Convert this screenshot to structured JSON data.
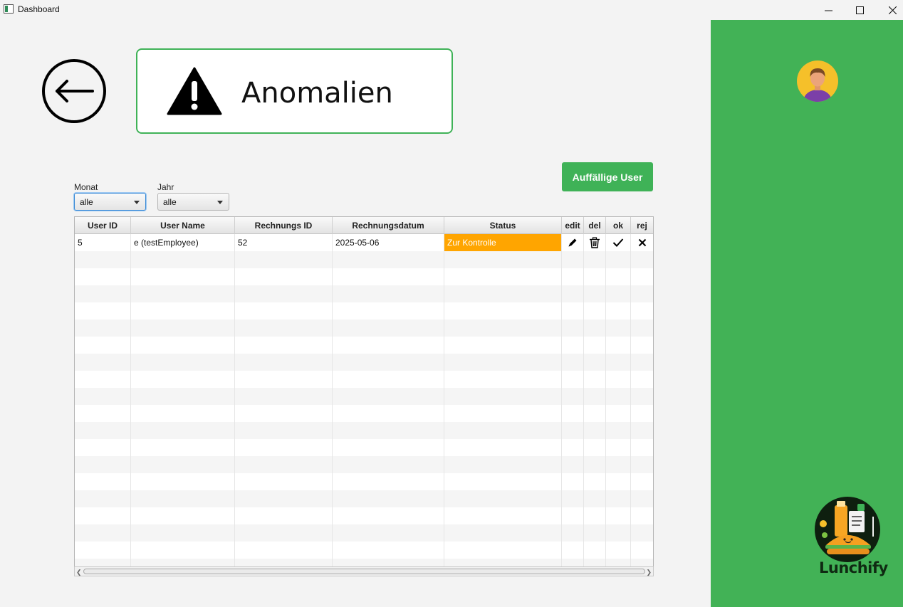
{
  "window": {
    "title": "Dashboard",
    "controls": [
      "minimize",
      "maximize",
      "close"
    ]
  },
  "header": {
    "title": "Anomalien",
    "back_icon": "arrow-left-circle-icon",
    "title_icon": "warning-icon"
  },
  "actions": {
    "suspicious_users_label": "Auffällige User"
  },
  "filters": {
    "month": {
      "label": "Monat",
      "value": "alle"
    },
    "year": {
      "label": "Jahr",
      "value": "alle"
    }
  },
  "table": {
    "columns": [
      "User ID",
      "User Name",
      "Rechnungs ID",
      "Rechnungsdatum",
      "Status",
      "edit",
      "del",
      "ok",
      "rej"
    ],
    "rows": [
      {
        "user_id": "5",
        "user_name": "e (testEmployee)",
        "invoice_id": "52",
        "invoice_date": "2025-05-06",
        "status": "Zur Kontrolle",
        "row_icons": [
          "pencil-icon",
          "trash-icon",
          "checkmark-icon",
          "x-icon"
        ]
      }
    ]
  },
  "sidebar": {
    "avatar_icon": "user-avatar-icon",
    "brand": "Lunchify"
  },
  "colors": {
    "accent_green": "#42b256",
    "status_orange": "#ffa500"
  }
}
